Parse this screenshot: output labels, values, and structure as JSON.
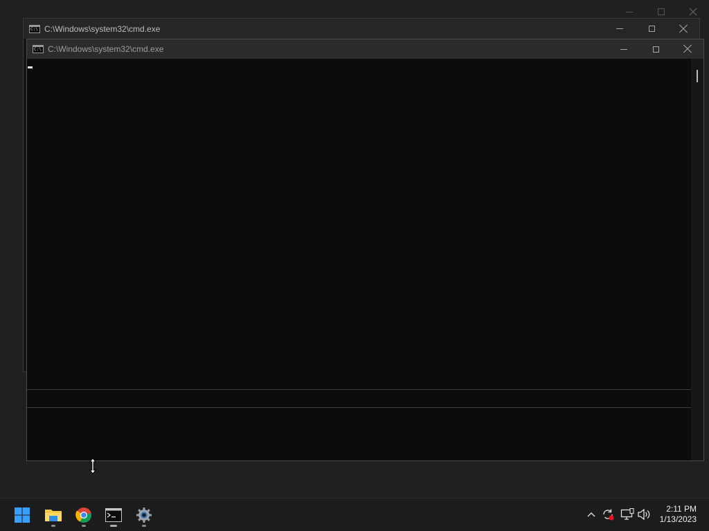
{
  "back_window": {
    "title": "C:\\Windows\\system32\\cmd.exe"
  },
  "front_window": {
    "title": "C:\\Windows\\system32\\cmd.exe"
  },
  "taskbar": {
    "apps": [
      {
        "name": "Start",
        "icon": "windows-start-icon"
      },
      {
        "name": "File Explorer",
        "icon": "folder-icon"
      },
      {
        "name": "Google Chrome",
        "icon": "chrome-icon"
      },
      {
        "name": "Command Prompt",
        "icon": "terminal-icon"
      },
      {
        "name": "Settings",
        "icon": "gear-icon"
      }
    ],
    "tray_icons": [
      "chevron-up-icon",
      "sync-icon",
      "network-icon",
      "speaker-icon"
    ],
    "clock": {
      "time": "2:11 PM",
      "date": "1/13/2023"
    }
  },
  "colors": {
    "desktop": "#202020",
    "console_bg": "#0c0c0c",
    "windows_blue": "#3aa0ff",
    "notification_red": "#e81123"
  }
}
